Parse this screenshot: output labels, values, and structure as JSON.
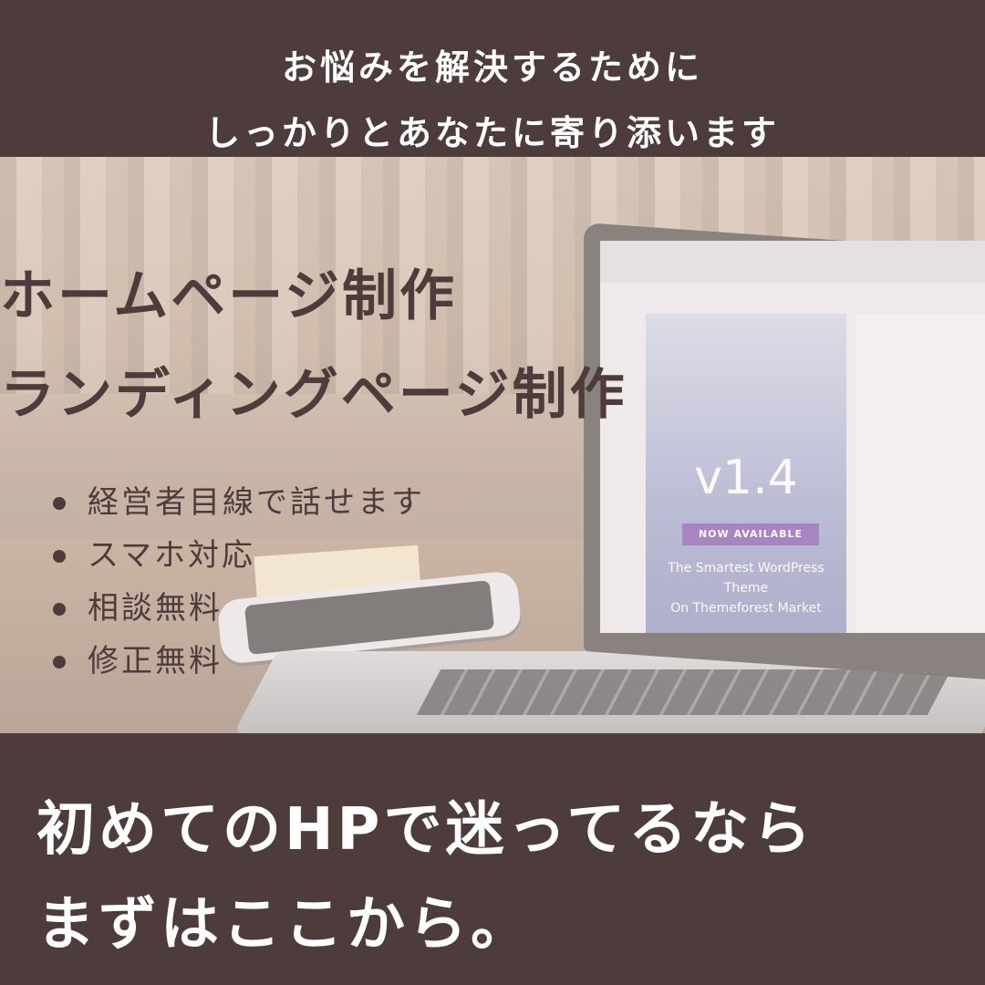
{
  "top_banner": {
    "line1": "お悩みを解決するために",
    "line2": "しっかりとあなたに寄り添います"
  },
  "headings": {
    "line1": "ホームページ制作",
    "line2": "ランディングページ制作"
  },
  "features": [
    "経営者目線で話せます",
    "スマホ対応",
    "相談無料",
    "修正無料"
  ],
  "laptop_screen": {
    "version": "v1.4",
    "badge": "NOW AVAILABLE",
    "tagline1": "The Smartest WordPress Theme",
    "tagline2": "On Themeforest Market"
  },
  "bottom_banner": {
    "line1": "初めてのHPで迷ってるなら",
    "line2": "まずはここから。"
  },
  "colors": {
    "band": "#4e3c3c",
    "text_light": "#ffffff",
    "text_dark": "#4e3c3c"
  }
}
